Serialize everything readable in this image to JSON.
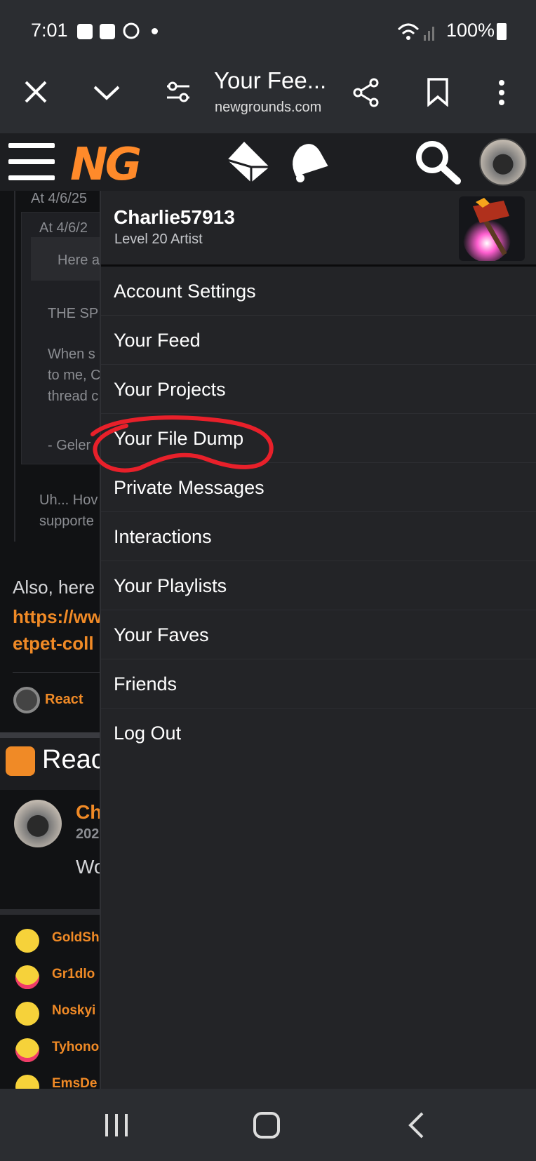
{
  "status_bar": {
    "time": "7:01",
    "battery": "100%"
  },
  "browser": {
    "title": "Your Fee...",
    "url": "newgrounds.com"
  },
  "menu": {
    "username": "Charlie57913",
    "level": "Level 20 Artist",
    "items": [
      {
        "label": "Account Settings"
      },
      {
        "label": "Your Feed"
      },
      {
        "label": "Your Projects"
      },
      {
        "label": "Your File Dump"
      },
      {
        "label": "Private Messages"
      },
      {
        "label": "Interactions"
      },
      {
        "label": "Your Playlists"
      },
      {
        "label": "Your Faves"
      },
      {
        "label": "Friends"
      },
      {
        "label": "Log Out"
      }
    ]
  },
  "background_page": {
    "quote_date_1": "At 4/6/25",
    "quote_date_2": "At 4/6/2",
    "snippet_1": "Here a",
    "snippet_2": "THE SP",
    "snippet_3": "When s",
    "snippet_4": "to me, C",
    "snippet_5": "thread c",
    "snippet_6": "- Geler",
    "snippet_7": "Uh... Hov",
    "snippet_8": "supporte",
    "also_text": "Also, here",
    "link_1": "https://ww",
    "link_2": "etpet-coll",
    "react_label": "React",
    "reactions_header": "React",
    "commenter_name": "Ch",
    "commenter_date": "202",
    "comment_text": "Wo",
    "reactors": [
      "GoldSh",
      "Gr1dlo",
      "Noskyi",
      "Tyhono",
      "EmsDe"
    ]
  },
  "colors": {
    "accent": "#f08a26",
    "menu_bg": "#232427",
    "annotation": "#e8202a"
  }
}
